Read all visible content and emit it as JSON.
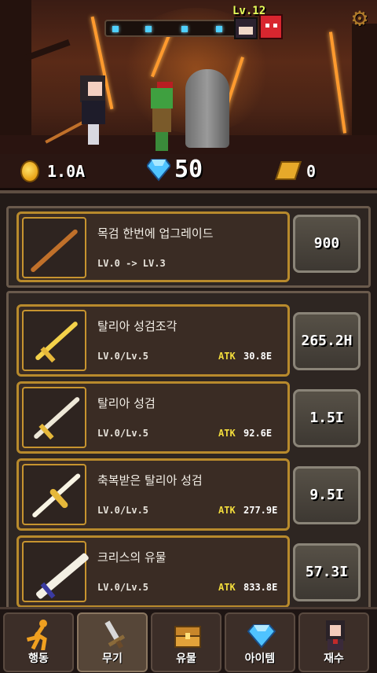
{
  "header": {
    "level": "Lv.12",
    "settings_icon": "gear-icon",
    "wave_dots": 4
  },
  "currency": {
    "gold": "1.0A",
    "gems": "50",
    "tickets": "0"
  },
  "upgrade": {
    "name": "목검 한번에 업그레이드",
    "level_text": "LV.0 -> LV.3",
    "price": "900"
  },
  "items": [
    {
      "name": "탈리아 성검조각",
      "level": "LV.0/Lv.5",
      "atk_label": "ATK",
      "atk": "30.8E",
      "price": "265.2H"
    },
    {
      "name": "탈리아 성검",
      "level": "LV.0/Lv.5",
      "atk_label": "ATK",
      "atk": "92.6E",
      "price": "1.5I"
    },
    {
      "name": "축복받은 탈리아 성검",
      "level": "LV.0/Lv.5",
      "atk_label": "ATK",
      "atk": "277.9E",
      "price": "9.5I"
    },
    {
      "name": "크리스의 유물",
      "level": "LV.0/Lv.5",
      "atk_label": "ATK",
      "atk": "833.8E",
      "price": "57.3I"
    }
  ],
  "nav": [
    {
      "label": "행동",
      "icon": "running-man-icon"
    },
    {
      "label": "무기",
      "icon": "sword-icon",
      "active": true
    },
    {
      "label": "유물",
      "icon": "treasure-chest-icon"
    },
    {
      "label": "아이템",
      "icon": "diamond-icon"
    },
    {
      "label": "재수",
      "icon": "character-portrait-icon"
    }
  ],
  "colors": {
    "gold_border": "#b88a2c",
    "atk_label": "#f2dc3c",
    "gem": "#4fc3ff"
  }
}
